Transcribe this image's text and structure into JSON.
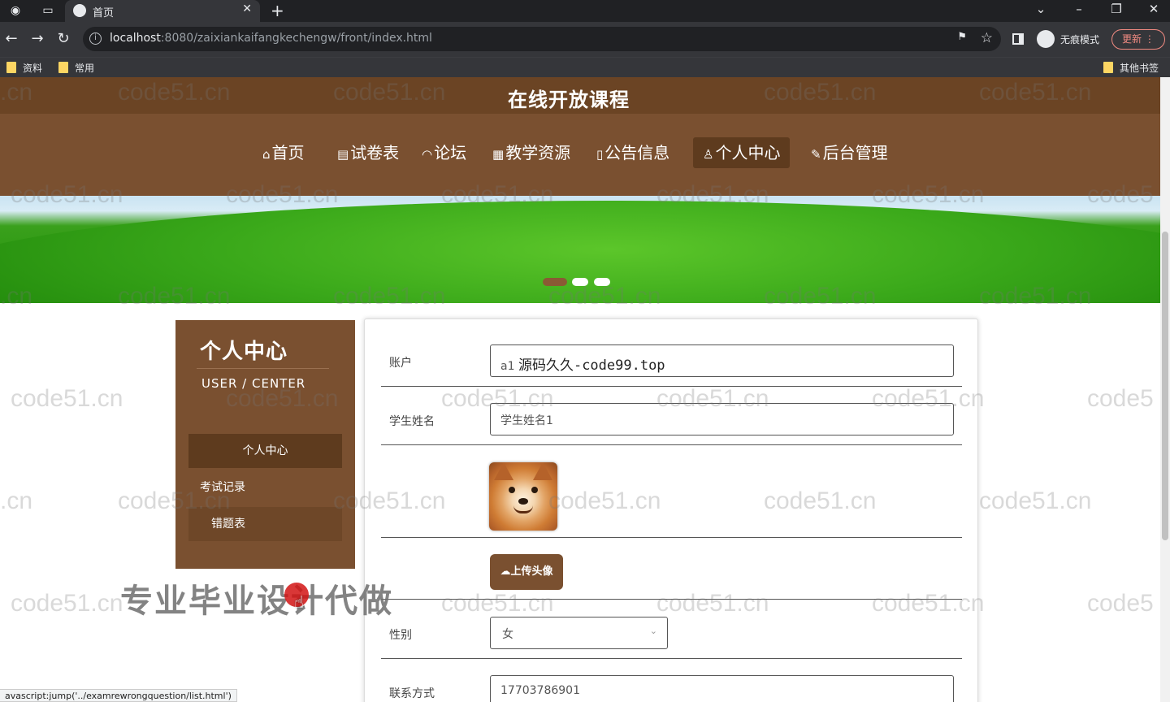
{
  "browser": {
    "tab_title": "首页",
    "url_host": "localhost",
    "url_rest": ":8080/zaixiankaifangkechengw/front/index.html",
    "incognito_label": "无痕模式",
    "update_label": "更新",
    "bookmarks": [
      "资料",
      "常用"
    ],
    "other_bookmarks": "其他书签",
    "status_url": "avascript:jump('../examrewrongquestion/list.html')"
  },
  "site": {
    "title": "在线开放课程",
    "nav": [
      {
        "icon": "⌂",
        "label": "首页"
      },
      {
        "icon": "▤",
        "label": "试卷表"
      },
      {
        "icon": "◠",
        "label": "论坛"
      },
      {
        "icon": "▦",
        "label": "教学资源"
      },
      {
        "icon": "▯",
        "label": "公告信息"
      },
      {
        "icon": "♙",
        "label": "个人中心"
      },
      {
        "icon": "✎",
        "label": "后台管理"
      }
    ],
    "carousel_active": 0
  },
  "sidebar": {
    "title": "个人中心",
    "subtitle": "USER / CENTER",
    "items": [
      "个人中心",
      "考试记录",
      "错题表"
    ]
  },
  "form": {
    "account_label": "账户",
    "account_value": "a1",
    "account_overlay": "源码久久-code99.top",
    "name_label": "学生姓名",
    "name_value": "学生姓名1",
    "upload_label": "上传头像",
    "gender_label": "性别",
    "gender_value": "女",
    "phone_label": "联系方式",
    "phone_value": "17703786901"
  },
  "watermarks": {
    "tile": "code51.cn",
    "tile_left": ".cn",
    "tile_right": "code5",
    "banner": "专业毕业设计代做"
  }
}
